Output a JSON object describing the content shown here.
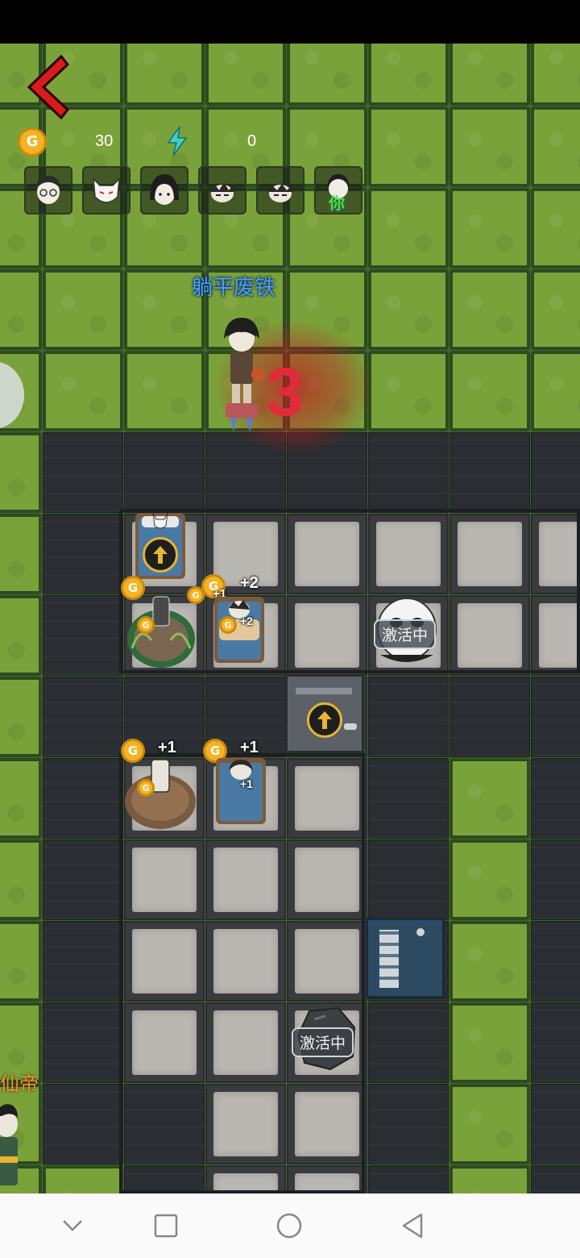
{
  "hud": {
    "coin_icon": "G",
    "coins": "30",
    "energy": "0"
  },
  "avatars": [
    {
      "name": "girl-glasses-avatar"
    },
    {
      "name": "fox-mask-avatar"
    },
    {
      "name": "black-hair-girl-avatar"
    },
    {
      "name": "sleeping-boy-avatar"
    },
    {
      "name": "sleeping-boy-2-avatar"
    },
    {
      "name": "you-avatar",
      "label": "你"
    }
  ],
  "player": {
    "name": "躺平废铁"
  },
  "countdown": "3",
  "floaters": {
    "plus2": "+2",
    "plus1": "+1",
    "plus1_small": "+1",
    "plus2_small": "+2"
  },
  "badges": {
    "active": "激活中"
  },
  "npc": {
    "name": "仙帝"
  },
  "colors": {
    "grass": "#7aa23a",
    "wall": "#2a2d31",
    "floor": "#b9b7b1",
    "countdown": "#e22a3a",
    "player_name": "#4aa0ff",
    "npc_name": "#f0922e",
    "coin": "#f5b324",
    "door_blue": "#2c4a62"
  },
  "nav": {
    "icons": [
      "chevron-down-icon",
      "square-recent-icon",
      "circle-home-icon",
      "triangle-back-icon"
    ]
  }
}
